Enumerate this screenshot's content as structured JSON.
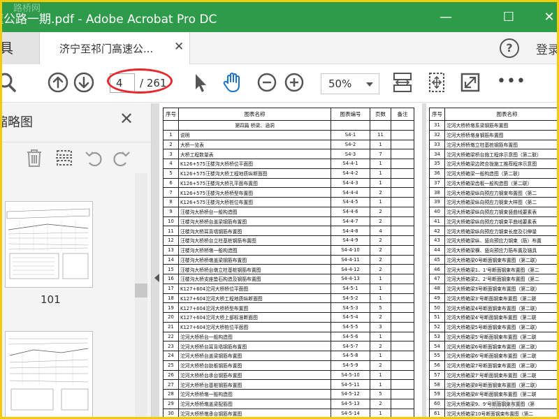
{
  "window": {
    "title": "高速公路一期.pdf - Adobe Acrobat Pro DC",
    "watermark": "路桥网",
    "min_glyph": "—",
    "max_glyph": "☐",
    "close_glyph": "✕"
  },
  "tabs": {
    "tools_partial": "具",
    "doc_tab_label": "济宁至祁门高速公...",
    "doc_tab_close": "✕",
    "help": "?",
    "login": "登录"
  },
  "toolbar": {
    "page_current": "4",
    "page_total": "/ 261",
    "zoom": "50%",
    "more": "•••"
  },
  "thumbnails": {
    "header": "缩略图",
    "close": "✕",
    "page_label": "101"
  },
  "colors": {
    "titlebar": "#2e9b4a",
    "highlight": "#e8262b",
    "frame": "#f2cc00",
    "hand_tool": "#1a73c8"
  },
  "left_table": {
    "headers": [
      "序号",
      "图表名称",
      "图表编号",
      "页数",
      "备注"
    ],
    "section": "第四篇  桥梁、涵洞",
    "rows": [
      [
        "1",
        "说明",
        "S4-1",
        "11"
      ],
      [
        "2",
        "大桥一览表",
        "S4-2",
        "1"
      ],
      [
        "3",
        "大桥工程数量表",
        "S4-3",
        "7"
      ],
      [
        "4",
        "K126+575汪楼沟大桥桥位平面图",
        "S4-4-1",
        "1"
      ],
      [
        "5",
        "K126+575汪楼沟大桥工程地质纵断面图",
        "S4-4-2",
        "1"
      ],
      [
        "6",
        "K126+575汪楼沟大桥孔平面布置图",
        "S4-4-3",
        "1"
      ],
      [
        "7",
        "K126+575汪楼沟大桥桥型布置图",
        "S4-4-4",
        "2"
      ],
      [
        "8",
        "K126+575汪楼沟大桥桩位布置图",
        "S4-4-5",
        "1"
      ],
      [
        "9",
        "汪楼沟大桥桥台一般构造图",
        "S4-4-6",
        "2"
      ],
      [
        "10",
        "汪楼沟大桥桥台盖梁钢筋布置图",
        "S4-4-7",
        "2"
      ],
      [
        "11",
        "汪楼沟大桥耳背墙钢筋布置图",
        "S4-4-8",
        "4"
      ],
      [
        "12",
        "汪楼沟大桥桥台立柱基桩钢筋布置图",
        "S4-4-9",
        "2"
      ],
      [
        "13",
        "汪楼沟大桥桥墩一般构造图",
        "S4-4-10",
        "2"
      ],
      [
        "14",
        "汪楼沟大桥桥墩盖梁钢筋布置图",
        "S4-4-11",
        "2"
      ],
      [
        "15",
        "汪楼沟大桥桥台墩立柱基桩钢筋布置图",
        "S4-4-12",
        "2"
      ],
      [
        "16",
        "汪楼沟大桥支座垫石构造及钢筋布置图",
        "S4-4-13",
        "1"
      ],
      [
        "17",
        "K127+604沱河大桥桥位平面图",
        "S4-5-1",
        "1"
      ],
      [
        "18",
        "K127+604沱河大桥工程地质纵断面图",
        "S4-5-2",
        "1"
      ],
      [
        "19",
        "K127+604沱河大桥桥型布置图",
        "S4-5-3",
        "5"
      ],
      [
        "20",
        "K127+604沱河大桥上部标准断面图",
        "S4-5-4",
        "2"
      ],
      [
        "21",
        "K127+604沱河大桥桩位平面图",
        "S4-5-5",
        "3"
      ],
      [
        "22",
        "沱河大桥桥台一般构造图",
        "S4-5-6",
        "1"
      ],
      [
        "23",
        "沱河大桥桥台耳背墙钢筋布置图",
        "S4-5-7",
        "2"
      ],
      [
        "24",
        "沱河大桥桥台盖梁钢筋布置图",
        "S4-5-8",
        "1"
      ],
      [
        "25",
        "沱河大桥桥台肋板钢筋布置图",
        "S4-5-9",
        "2"
      ],
      [
        "26",
        "沱河大桥桥台承台钢筋布置图",
        "S4-5-10",
        "1"
      ],
      [
        "27",
        "沱河大桥桥台基桩钢筋布置图",
        "S4-5-11",
        "1"
      ],
      [
        "28",
        "沱河大桥桥墩一般构造图",
        "S4-5-12",
        "5"
      ],
      [
        "29",
        "沱河大桥桥墩盖梁配筋图",
        "S4-5-13",
        "2"
      ],
      [
        "30",
        "沱河大桥桥墩承台钢筋布置图",
        "S4-5-14",
        "1"
      ]
    ]
  },
  "right_table": {
    "headers": [
      "序号",
      "图表名称"
    ],
    "rows": [
      [
        "31",
        "沱河大桥桥墩系梁钢筋布置图"
      ],
      [
        "32",
        "沱河大桥桥墩身钢筋布置图"
      ],
      [
        "33",
        "沱河大桥桥墩立柱基桩钢筋布置图"
      ],
      [
        "34",
        "沱河大桥箱梁桥台施工程序示意图（第二联）"
      ],
      [
        "35",
        "沱河大桥箱梁边跨合拢施工推荐程序示意图"
      ],
      [
        "36",
        "沱河大桥箱梁一般构造图（第二联）"
      ],
      [
        "37",
        "沱河大桥箱梁齿板一般构造图（第二联）"
      ],
      [
        "38",
        "沱河大桥箱梁纵向预应力钢束布置图（第二"
      ],
      [
        "39",
        "沱河大桥箱梁纵向预应力钢束大样图（第二"
      ],
      [
        "40",
        "沱河大桥箱梁纵向预应力钢束竖曲线要素表"
      ],
      [
        "41",
        "沱河大桥箱梁纵向预应力钢束平曲线要素表"
      ],
      [
        "42",
        "沱河大桥箱梁纵向预应力钢束长度及引伸量"
      ],
      [
        "43",
        "沱河大桥箱梁纵、竖向预应力钢束（筋）布置"
      ],
      [
        "44",
        "沱河大桥箱梁横、竖向预应力筋布置及锚具"
      ],
      [
        "45",
        "沱河大桥箱梁0号断面钢束布置图（第二联）"
      ],
      [
        "46",
        "沱河大桥箱梁1、1'号断面钢束布置图（第二"
      ],
      [
        "47",
        "沱河大桥箱梁2、2'号断面钢束布置图（第二"
      ],
      [
        "48",
        "沱河大桥箱梁3号断面钢束布置图（第二联）"
      ],
      [
        "49",
        "沱河大桥箱梁3'号断面钢束布置图（第二联"
      ],
      [
        "50",
        "沱河大桥箱梁4号断面钢束布置图（第二联）"
      ],
      [
        "51",
        "沱河大桥箱梁4'号断面钢束布置图（第二联"
      ],
      [
        "52",
        "沱河大桥箱梁5号断面钢束布置图（第二联）"
      ],
      [
        "53",
        "沱河大桥箱梁5'号断面钢束布置图（第二联"
      ],
      [
        "54",
        "沱河大桥箱梁6号断面钢束布置图（第二联）"
      ],
      [
        "55",
        "沱河大桥箱梁6'号断面钢束布置图（第二联"
      ],
      [
        "56",
        "沱河大桥箱梁7号断面钢束布置图（第二联）"
      ],
      [
        "57",
        "沱河大桥箱梁7'号断面钢束布置图（第二联"
      ],
      [
        "58",
        "沱河大桥箱梁8号断面钢束布置图（第二联）"
      ],
      [
        "59",
        "沱河大桥箱梁8'号断面钢束布置图（第二联"
      ],
      [
        "60",
        "沱河大桥箱梁9、9'号断面钢束布置图（第"
      ],
      [
        "61",
        "沱河大桥箱梁10号断面钢束布置图（第二"
      ]
    ]
  }
}
